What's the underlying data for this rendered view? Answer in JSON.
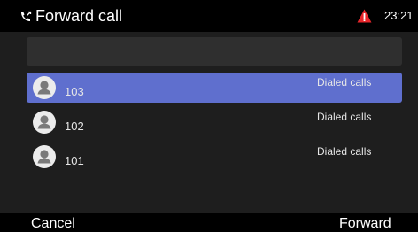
{
  "header": {
    "title": "Forward call",
    "time": "23:21",
    "title_icon": "phone-forward-icon",
    "alert_icon": "warning-triangle-icon",
    "alert_color": "#e8262b"
  },
  "search": {
    "value": ""
  },
  "contacts": [
    {
      "number": "103",
      "label": "Dialed calls",
      "selected": true,
      "icon": "contact-avatar-icon"
    },
    {
      "number": "102",
      "label": "Dialed calls",
      "selected": false,
      "icon": "contact-avatar-icon"
    },
    {
      "number": "101",
      "label": "Dialed calls",
      "selected": false,
      "icon": "contact-avatar-icon"
    }
  ],
  "softkeys": {
    "left": "Cancel",
    "right": "Forward"
  },
  "colors": {
    "selected_row": "#5f6fce",
    "content_bg": "#1e1e1e",
    "search_bg": "#2f2f2f"
  }
}
